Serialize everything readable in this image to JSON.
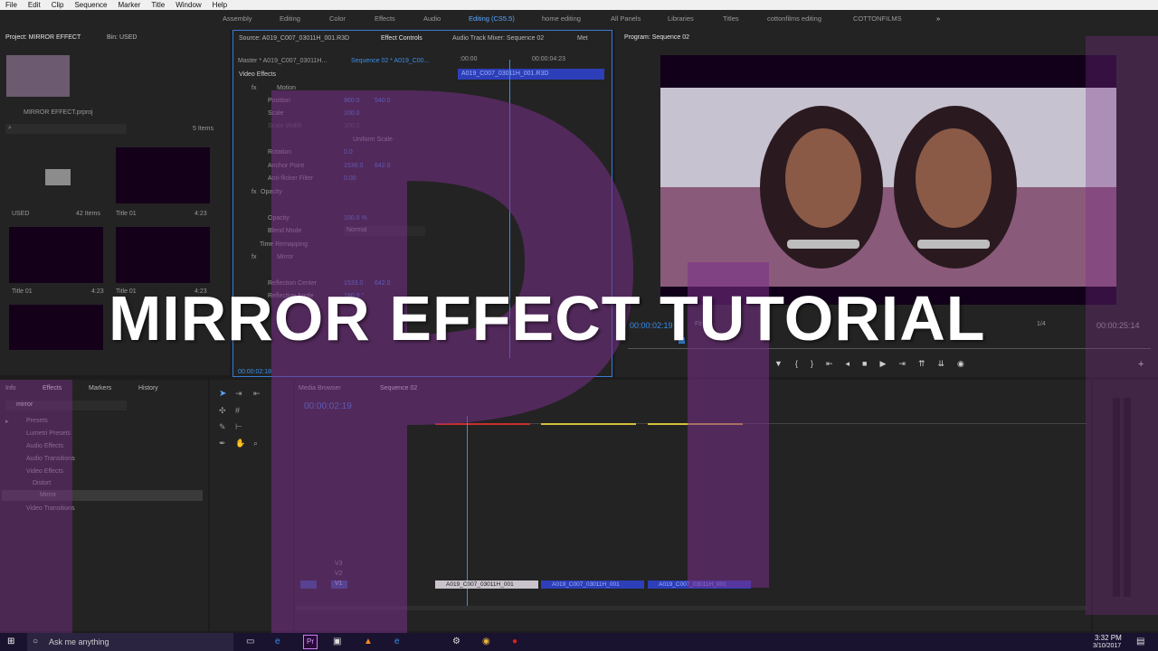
{
  "menu": [
    "File",
    "Edit",
    "Clip",
    "Sequence",
    "Marker",
    "Title",
    "Window",
    "Help"
  ],
  "workspaces": [
    "Assembly",
    "Editing",
    "Color",
    "Effects",
    "Audio",
    "Editing (CS5.5)",
    "home editing",
    "All Panels",
    "Libraries",
    "Titles",
    "cottonfilms editing",
    "COTTONFILMS"
  ],
  "project": {
    "tab": "Project: MIRROR EFFECT",
    "bin_tab": "Bin: USED",
    "file": "MIRROR EFFECT.prproj",
    "item_count": "5 Items",
    "items": [
      {
        "name": "USED",
        "meta": "42 Items"
      },
      {
        "name": "Title 01",
        "meta": "4:23"
      },
      {
        "name": "Title 01",
        "meta": "4:23"
      },
      {
        "name": "Title 01",
        "meta": "4:23"
      }
    ]
  },
  "effect_controls": {
    "source_tab": "Source: A019_C007_03011H_001.R3D",
    "tab": "Effect Controls",
    "mixer_tab": "Audio Track Mixer: Sequence 02",
    "meta_tab": "Met",
    "master": "Master * A019_C007_03011H...",
    "sequence": "Sequence 02 * A019_C00...",
    "ruler_start": ":00:00",
    "ruler_end": "00:00:04:23",
    "clip_label": "A019_C007_03011H_001.R3D",
    "section": "Video Effects",
    "rows": [
      {
        "label": "Motion",
        "v1": "",
        "v2": ""
      },
      {
        "label": "Position",
        "v1": "960.0",
        "v2": "540.0"
      },
      {
        "label": "Scale",
        "v1": "100.0",
        "v2": ""
      },
      {
        "label": "Scale Width",
        "v1": "100.0",
        "v2": ""
      },
      {
        "label": "Uniform Scale",
        "v1": "",
        "v2": ""
      },
      {
        "label": "Rotation",
        "v1": "0.0",
        "v2": ""
      },
      {
        "label": "Anchor Point",
        "v1": "1536.0",
        "v2": "642.0"
      },
      {
        "label": "Anti-flicker Filter",
        "v1": "0.00",
        "v2": ""
      },
      {
        "label": "Opacity",
        "v1": "",
        "v2": ""
      },
      {
        "label": "Opacity",
        "v1": "100.0 %",
        "v2": ""
      },
      {
        "label": "Blend Mode",
        "v1": "Normal",
        "v2": ""
      },
      {
        "label": "Time Remapping",
        "v1": "",
        "v2": ""
      },
      {
        "label": "Mirror",
        "v1": "",
        "v2": ""
      },
      {
        "label": "Reflection Center",
        "v1": "1533.0",
        "v2": "642.0"
      },
      {
        "label": "Reflection Angle",
        "v1": "180.0 °",
        "v2": ""
      }
    ],
    "timecode": "00:00:02:18"
  },
  "program": {
    "tab": "Program: Sequence 02",
    "timecode": "00:00:02:19",
    "fit": "Fit",
    "ratio": "1/4",
    "duration": "00:00:25:14"
  },
  "effects_panel": {
    "tabs": [
      "Info",
      "Effects",
      "Markers",
      "History"
    ],
    "search": "mirror",
    "tree": [
      "Presets",
      "Lumetri Presets",
      "Audio Effects",
      "Audio Transitions",
      "Video Effects",
      "Distort",
      "Mirror",
      "Video Transitions"
    ]
  },
  "timeline": {
    "tabs": [
      "Media Browser",
      "Sequence 02"
    ],
    "timecode": "00:00:02:19",
    "tracks": [
      "V3",
      "V2",
      "V1"
    ],
    "clips": [
      "A019_C007_03011H_001",
      "A019_C007_03011H_001",
      "A019_C007_03011H_001"
    ]
  },
  "overlay_title": "MIRROR EFFECT TUTORIAL",
  "taskbar": {
    "search": "Ask me anything",
    "time": "3:32 PM",
    "date": "3/10/2017"
  },
  "colors": {
    "accent": "#3a8ee8",
    "overlay_purple": "#7a2f8a",
    "clip_blue": "#2d3fb8"
  }
}
